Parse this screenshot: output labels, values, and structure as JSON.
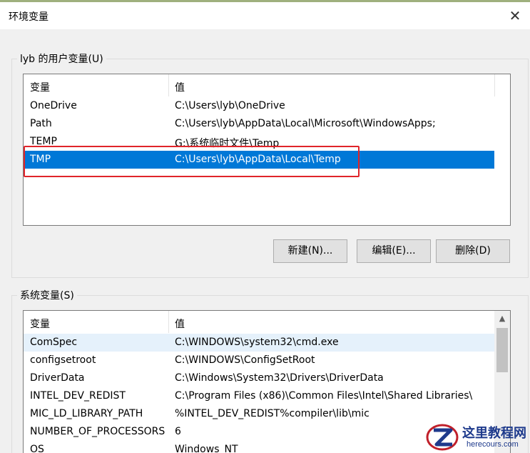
{
  "window": {
    "title": "环境变量",
    "close_label": "✕"
  },
  "user_vars": {
    "legend": "lyb 的用户变量(U)",
    "header": {
      "col1": "变量",
      "col2": "值"
    },
    "rows": [
      {
        "name": "OneDrive",
        "value": "C:\\Users\\lyb\\OneDrive"
      },
      {
        "name": "Path",
        "value": "C:\\Users\\lyb\\AppData\\Local\\Microsoft\\WindowsApps;"
      },
      {
        "name": "TEMP",
        "value": "G:\\系统临时文件\\Temp"
      },
      {
        "name": "TMP",
        "value": "C:\\Users\\lyb\\AppData\\Local\\Temp"
      }
    ],
    "selected_index": 3,
    "buttons": {
      "new": "新建(N)...",
      "edit": "编辑(E)...",
      "delete": "删除(D)"
    }
  },
  "system_vars": {
    "legend": "系统变量(S)",
    "header": {
      "col1": "变量",
      "col2": "值"
    },
    "rows": [
      {
        "name": "ComSpec",
        "value": "C:\\WINDOWS\\system32\\cmd.exe"
      },
      {
        "name": "configsetroot",
        "value": "C:\\WINDOWS\\ConfigSetRoot"
      },
      {
        "name": "DriverData",
        "value": "C:\\Windows\\System32\\Drivers\\DriverData"
      },
      {
        "name": "INTEL_DEV_REDIST",
        "value": "C:\\Program Files (x86)\\Common Files\\Intel\\Shared Libraries\\"
      },
      {
        "name": "MIC_LD_LIBRARY_PATH",
        "value": "%INTEL_DEV_REDIST%compiler\\lib\\mic"
      },
      {
        "name": "NUMBER_OF_PROCESSORS",
        "value": "6"
      },
      {
        "name": "OS",
        "value": "Windows_NT"
      }
    ]
  },
  "watermark": {
    "text": "这里教程网",
    "url": "herecours.com"
  },
  "colors": {
    "selection": "#0078d7",
    "highlight_box": "#e0242a",
    "watermark": "#1e3a8c"
  }
}
